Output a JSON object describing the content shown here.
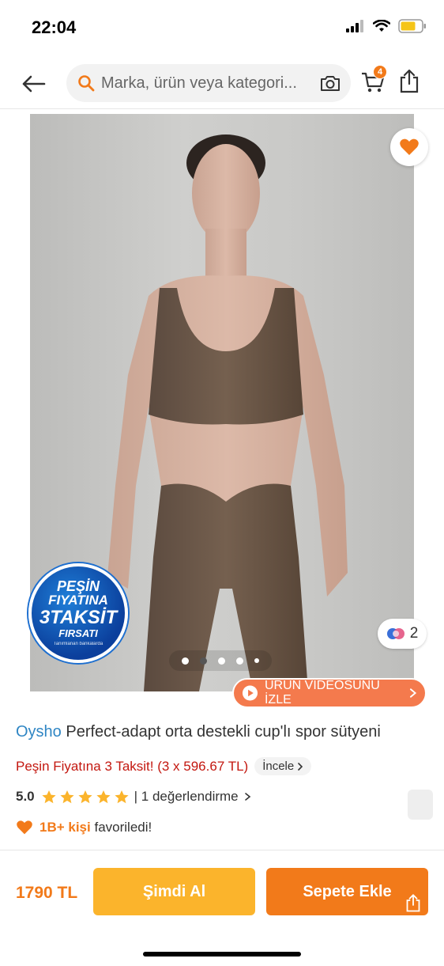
{
  "status_bar": {
    "time": "22:04"
  },
  "header": {
    "search_placeholder": "Marka, ürün veya kategori...",
    "cart_count": "4"
  },
  "gallery": {
    "promo_badge": {
      "line1": "PEŞİN",
      "line2": "FIYATINA",
      "line3": "3TAKSİT",
      "line4": "FIRSATI",
      "line5": "Tanımlanan bankalarda"
    },
    "active_image_index": 1,
    "image_count": 5,
    "color_count": "2",
    "video_button_label": "ÜRÜN VİDEOSUNU İZLE"
  },
  "product": {
    "brand": "Oysho",
    "name": "Perfect-adapt orta destekli cup'lı spor sütyeni",
    "installment_text": "Peşin Fiyatına 3 Taksit! (3 x 596.67 TL)",
    "incele_label": "İncele",
    "rating_score": "5.0",
    "stars": 5,
    "review_text": "| 1 değerlendirme",
    "fav_count": "1B+ kişi",
    "fav_suffix": "favoriledi!"
  },
  "bottom_bar": {
    "price": "1790 TL",
    "buy_now_label": "Şimdi Al",
    "add_to_cart_label": "Sepete Ekle"
  },
  "colors": {
    "accent": "#f27a1a",
    "buy_now": "#fbb42c",
    "installment_red": "#c3170f",
    "brand_blue": "#2f86c4"
  }
}
